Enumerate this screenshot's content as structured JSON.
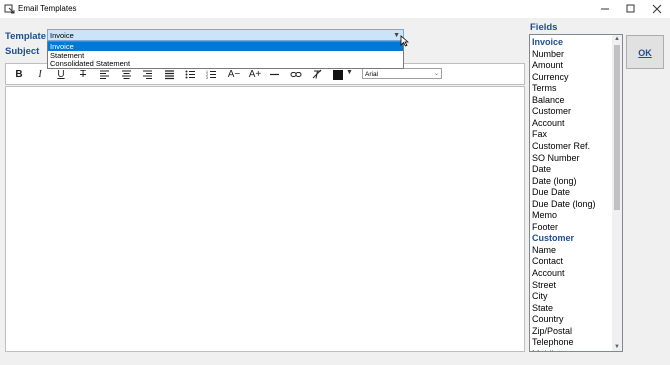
{
  "window": {
    "title": "Email Templates",
    "minimize_icon": "minimize-icon",
    "maximize_icon": "maximize-icon",
    "close_icon": "close-icon"
  },
  "form": {
    "template_label": "Template",
    "subject_label": "Subject",
    "fields_label": "Fields"
  },
  "template_select": {
    "value": "Invoice",
    "options": [
      "Invoice",
      "Statement",
      "Consolidated Statement"
    ],
    "selected_index": 0
  },
  "toolbar": {
    "buttons": [
      "bold-icon",
      "italic-icon",
      "underline-icon",
      "strikethrough-icon",
      "align-left-icon",
      "align-center-icon",
      "align-right-icon",
      "justify-icon",
      "bullet-list-icon",
      "numbered-list-icon",
      "decrease-font-icon",
      "increase-font-icon",
      "horizontal-rule-icon",
      "link-icon",
      "clear-format-icon"
    ],
    "font_color": "#111111",
    "font_value": "Arial"
  },
  "fields": [
    {
      "label": "Invoice",
      "header": true
    },
    {
      "label": "Number"
    },
    {
      "label": "Amount"
    },
    {
      "label": "Currency"
    },
    {
      "label": "Terms"
    },
    {
      "label": "Balance"
    },
    {
      "label": "Customer"
    },
    {
      "label": "Account"
    },
    {
      "label": "Fax"
    },
    {
      "label": "Customer Ref."
    },
    {
      "label": "SO Number"
    },
    {
      "label": "Date"
    },
    {
      "label": "Date (long)"
    },
    {
      "label": "Due Date"
    },
    {
      "label": "Due Date (long)"
    },
    {
      "label": "Memo"
    },
    {
      "label": "Footer"
    },
    {
      "label": "Customer",
      "header": true
    },
    {
      "label": "Name"
    },
    {
      "label": "Contact"
    },
    {
      "label": "Account"
    },
    {
      "label": "Street"
    },
    {
      "label": "City"
    },
    {
      "label": "State"
    },
    {
      "label": "Country"
    },
    {
      "label": "Zip/Postal"
    },
    {
      "label": "Telephone"
    },
    {
      "label": "Mobile"
    }
  ],
  "ok_button": {
    "label": "OK"
  },
  "colors": {
    "accent": "#1f4e8c",
    "selection": "#0078d7",
    "combo_highlight": "#cce4f7"
  }
}
